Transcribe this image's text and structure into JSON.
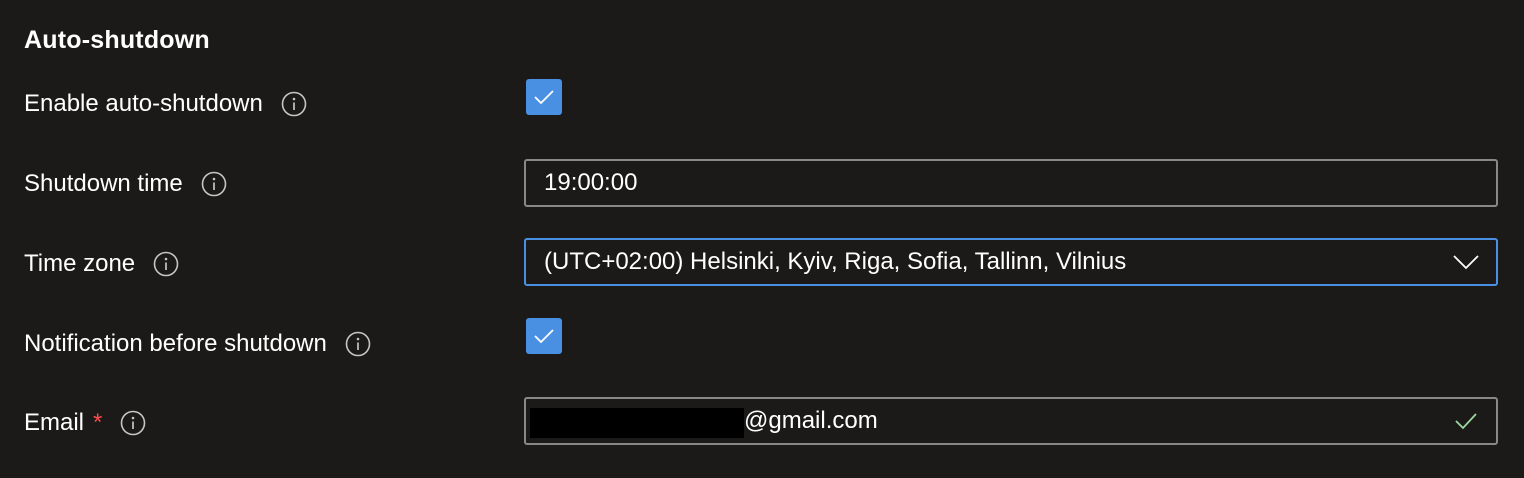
{
  "section": {
    "title": "Auto-shutdown"
  },
  "rows": {
    "enable": {
      "label": "Enable auto-shutdown",
      "checked": true
    },
    "shutdown_time": {
      "label": "Shutdown time",
      "value": "19:00:00"
    },
    "time_zone": {
      "label": "Time zone",
      "selected": "(UTC+02:00) Helsinki, Kyiv, Riga, Sofia, Tallinn, Vilnius"
    },
    "notification": {
      "label": "Notification before shutdown",
      "checked": true
    },
    "email": {
      "label": "Email",
      "required_marker": "*",
      "visible_value": "@gmail.com",
      "redacted": true
    }
  },
  "icons": {
    "info": "info-circle-icon",
    "checkmark": "checkmark-icon",
    "chevron": "chevron-down-icon",
    "valid": "validation-check-icon"
  },
  "colors": {
    "background": "#1b1a19",
    "text": "#ffffff",
    "accent": "#4a90e2",
    "field_border": "#8a8886",
    "required": "#ff4b4b",
    "valid_check": "#9fd89f",
    "info_icon": "#c8c6c4"
  }
}
